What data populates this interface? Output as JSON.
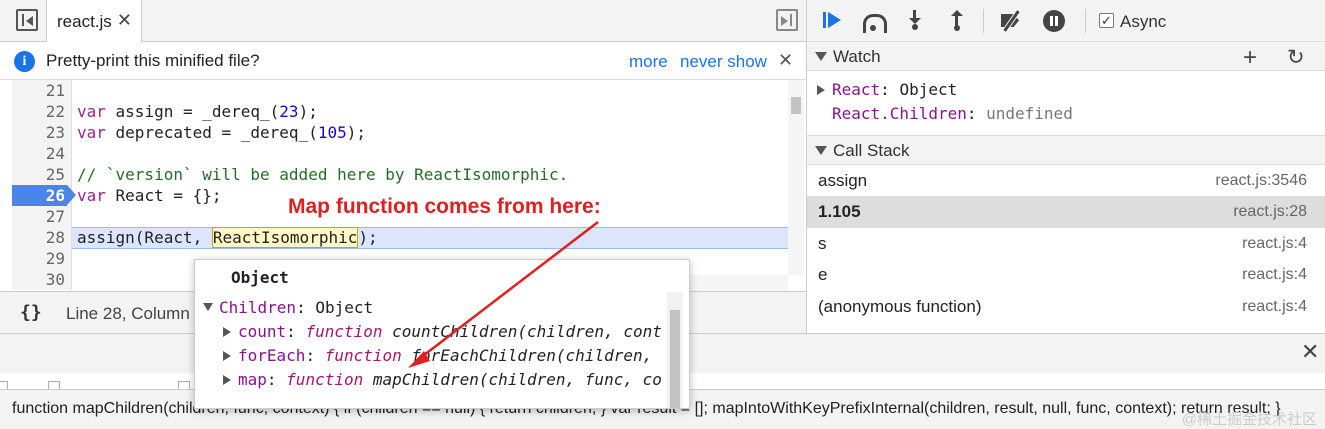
{
  "editor": {
    "tab_label": "react.js",
    "tab_close": "✕",
    "infobar": {
      "icon": "i",
      "text": "Pretty-print this minified file?",
      "more": "more",
      "never_show": "never show",
      "close": "✕"
    },
    "lines": [
      {
        "no": "21",
        "code": ""
      },
      {
        "no": "22",
        "code": "var assign = _dereq_(23);"
      },
      {
        "no": "23",
        "code": "var deprecated = _dereq_(105);"
      },
      {
        "no": "24",
        "code": ""
      },
      {
        "no": "25",
        "code": "// `version` will be added here by ReactIsomorphic."
      },
      {
        "no": "26",
        "code": "var React = {};"
      },
      {
        "no": "27",
        "code": ""
      },
      {
        "no": "28",
        "code_before": "assign(React, ",
        "code_hover": "ReactIsomorphic",
        "code_after": ");"
      },
      {
        "no": "29",
        "code": ""
      },
      {
        "no": "30",
        "code": "  "
      }
    ],
    "breakpoint_line": "26",
    "status_text": "Line 28, Column"
  },
  "debugger": {
    "async_label": "Async",
    "async_checked": "✓",
    "watch": {
      "title": "Watch",
      "add": "+",
      "refresh": "↻",
      "items": [
        {
          "name": "React",
          "sep": ": ",
          "value": "Object"
        },
        {
          "name": "React.Children",
          "sep": ": ",
          "value": "undefined"
        }
      ]
    },
    "call_stack": {
      "title": "Call Stack",
      "frames": [
        {
          "fn": "assign",
          "loc": "react.js:3546"
        },
        {
          "fn": "1.105",
          "loc": "react.js:28"
        },
        {
          "fn": "s",
          "loc": "react.js:4"
        },
        {
          "fn": "e",
          "loc": "react.js:4"
        },
        {
          "fn": "(anonymous function)",
          "loc": "react.js:4"
        }
      ]
    }
  },
  "popover": {
    "title": "Object",
    "root_name": "Children",
    "root_value": "Object",
    "props": [
      {
        "name": "count",
        "kw": "function",
        "sig": "countChildren(children, cont"
      },
      {
        "name": "forEach",
        "kw": "function",
        "sig": "forEachChildren(children,"
      },
      {
        "name": "map",
        "kw": "function",
        "sig": "mapChildren(children, func, co"
      }
    ]
  },
  "drawer": {
    "close": "✕"
  },
  "tooltip_text": "function mapChildren(children, func, context) { if (children == null) { return children; } var result = []; mapIntoWithKeyPrefixInternal(children, result, null, func, context); return result; }",
  "annotation": "Map function comes from here:",
  "watermark": "@稀土掘金技术社区",
  "colors": {
    "accent": "#1a73e8",
    "annotation": "#e02020",
    "breakpoint": "#4a86e8"
  }
}
